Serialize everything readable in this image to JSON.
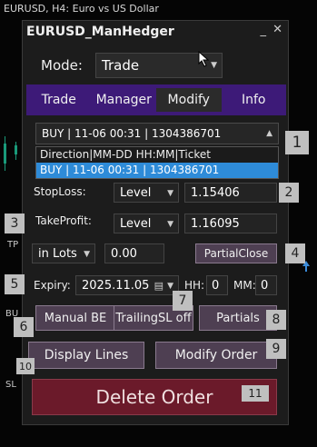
{
  "chart": {
    "title": "EURUSD, H4:  Euro vs US Dollar",
    "tags": [
      "TP",
      "BU",
      "SL"
    ]
  },
  "panel": {
    "title": "EURUSD_ManHedger",
    "minimize": "_",
    "close": "✕",
    "mode_label": "Mode:",
    "mode_value": "Trade",
    "tabs": [
      "Trade",
      "Manager",
      "Modify",
      "Info"
    ],
    "active_tab": "Modify",
    "order_select": "BUY | 11-06 00:31 | 1304386701",
    "dropdown_items": [
      "Direction|MM-DD HH:MM|Ticket",
      "BUY | 11-06 00:31 | 1304386701"
    ],
    "stoploss": {
      "label": "StopLoss:",
      "type": "Level",
      "value": "1.15406"
    },
    "takeprofit": {
      "label": "TakeProfit:",
      "type": "Level",
      "value": "1.16095"
    },
    "partial": {
      "unit": "in Lots",
      "value": "0.00",
      "button": "PartialClose"
    },
    "expiry": {
      "label": "Expiry:",
      "date": "2025.11.05",
      "hh_label": "HH:",
      "hh": "0",
      "mm_label": "MM:",
      "mm": "0"
    },
    "buttons": {
      "manual_be": "Manual BE",
      "trailing": "TrailingSL off",
      "partials": "Partials",
      "display_lines": "Display Lines",
      "modify_order": "Modify Order",
      "delete_order": "Delete Order"
    },
    "badges": [
      "1",
      "2",
      "3",
      "4",
      "5",
      "6",
      "7",
      "8",
      "9",
      "10",
      "11"
    ]
  }
}
